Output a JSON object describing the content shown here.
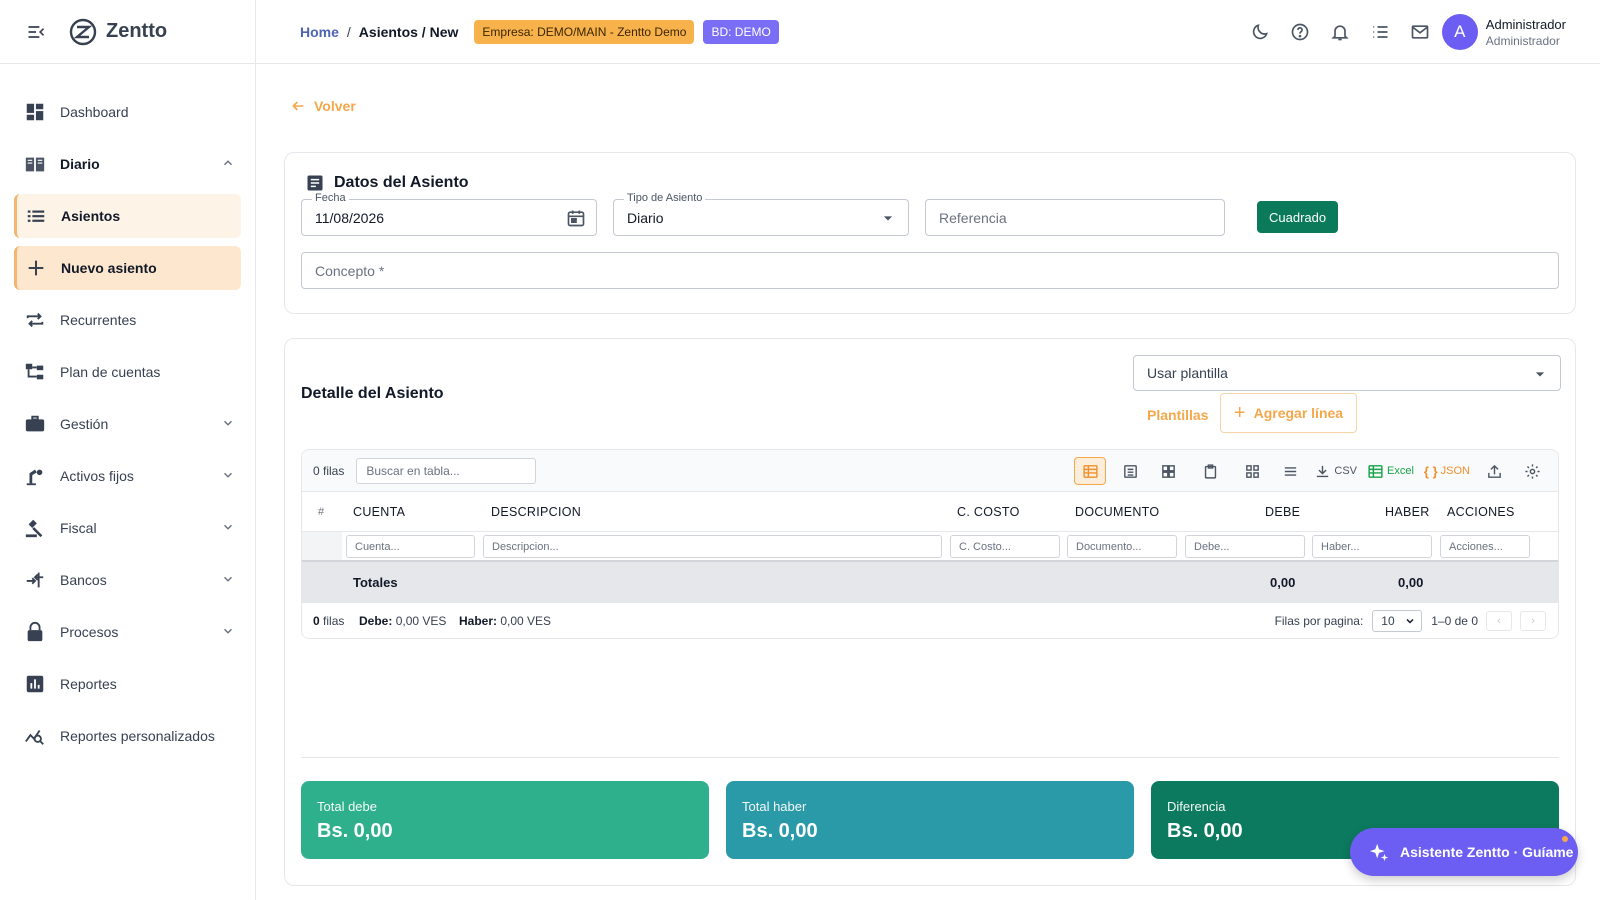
{
  "app": {
    "brand": "Zentto"
  },
  "sidebar": {
    "items": [
      {
        "label": "Dashboard",
        "icon": "dashboard-icon"
      },
      {
        "label": "Diario",
        "icon": "book-icon"
      },
      {
        "label": "Asientos",
        "icon": "list-icon"
      },
      {
        "label": "Nuevo asiento",
        "icon": "plus-icon"
      },
      {
        "label": "Recurrentes",
        "icon": "repeat-icon"
      },
      {
        "label": "Plan de cuentas",
        "icon": "tree-icon"
      },
      {
        "label": "Gestión",
        "icon": "briefcase-icon"
      },
      {
        "label": "Activos fijos",
        "icon": "assets-icon"
      },
      {
        "label": "Fiscal",
        "icon": "gavel-icon"
      },
      {
        "label": "Bancos",
        "icon": "transfer-icon"
      },
      {
        "label": "Procesos",
        "icon": "lock-icon"
      },
      {
        "label": "Reportes",
        "icon": "bar-chart-icon"
      },
      {
        "label": "Reportes personalizados",
        "icon": "analytics-icon"
      }
    ]
  },
  "header": {
    "breadcrumb_home": "Home",
    "breadcrumb_sep": "/",
    "breadcrumb_current": "Asientos / New",
    "company_tag": "Empresa: DEMO/MAIN - Zentto Demo",
    "db_tag": "BD: DEMO",
    "user_initial": "A",
    "user_name": "Administrador",
    "user_role": "Administrador"
  },
  "back_label": "Volver",
  "form": {
    "title": "Datos del Asiento",
    "fecha_label": "Fecha",
    "fecha_value": "11/08/2026",
    "tipo_label": "Tipo de Asiento",
    "tipo_value": "Diario",
    "referencia_placeholder": "Referencia",
    "status_button": "Cuadrado",
    "concepto_placeholder": "Concepto *"
  },
  "detail": {
    "title": "Detalle del Asiento",
    "template_select": "Usar plantilla",
    "plantillas_button": "Plantillas",
    "add_line_button": "Agregar línea"
  },
  "grid": {
    "rows_count": "0 filas",
    "search_placeholder": "Buscar en tabla...",
    "tools": {
      "csv": "CSV",
      "excel": "Excel",
      "json": "JSON"
    },
    "columns": [
      "#",
      "CUENTA",
      "DESCRIPCION",
      "C. COSTO",
      "DOCUMENTO",
      "DEBE",
      "HABER",
      "ACCIONES"
    ],
    "filters": [
      "Cuenta...",
      "Descripcion...",
      "C. Costo...",
      "Documento...",
      "Debe...",
      "Haber...",
      "Acciones..."
    ],
    "totals_label": "Totales",
    "totals_debe": "0,00",
    "totals_haber": "0,00",
    "footer": {
      "rows_num": "0",
      "rows_word": "filas",
      "debe_label": "Debe:",
      "debe_value": "0,00 VES",
      "haber_label": "Haber:",
      "haber_value": "0,00 VES",
      "rows_per_page_label": "Filas por pagina:",
      "rows_per_page": "10",
      "range": "1–0 de 0",
      "prev": "‹",
      "next": "›"
    }
  },
  "summary": [
    {
      "label": "Total debe",
      "value": "Bs. 0,00",
      "color": "#2fb08c"
    },
    {
      "label": "Total haber",
      "value": "Bs. 0,00",
      "color": "#2a9aa8"
    },
    {
      "label": "Diferencia",
      "value": "Bs. 0,00",
      "color": "#0c7a5e"
    }
  ],
  "assistant": {
    "label": "Asistente Zentto · Guíame"
  },
  "colors": {
    "accent": "#f4a74b",
    "primary": "#6d5ef3",
    "success": "#0b7a5a"
  }
}
